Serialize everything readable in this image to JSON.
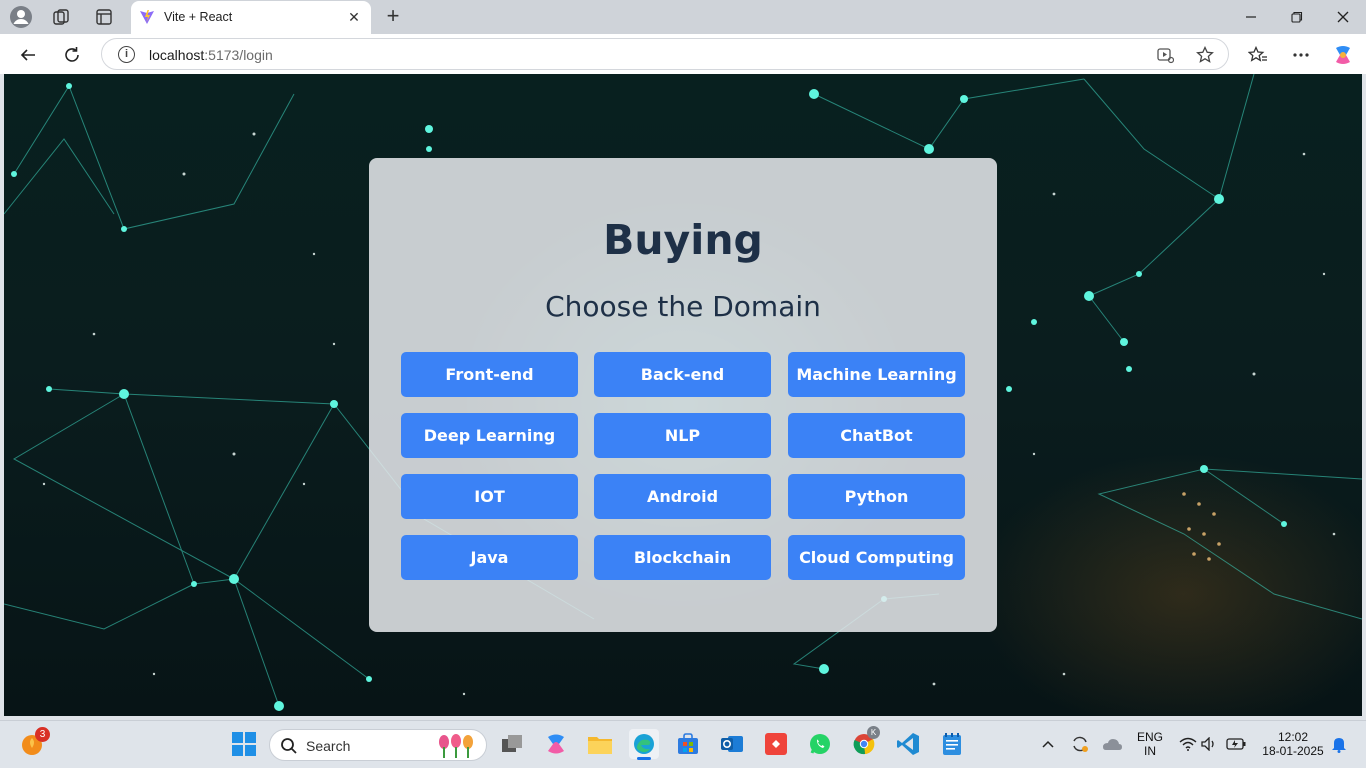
{
  "browser": {
    "tab_title": "Vite + React",
    "new_tab": "+",
    "tab_close": "✕",
    "url_host": "localhost",
    "url_rest": ":5173/login",
    "info_icon": "i"
  },
  "card": {
    "title": "Buying",
    "subtitle": "Choose the Domain",
    "domains": [
      "Front-end",
      "Back-end",
      "Machine Learning",
      "Deep Learning",
      "NLP",
      "ChatBot",
      "IOT",
      "Android",
      "Python",
      "Java",
      "Blockchain",
      "Cloud Computing"
    ]
  },
  "taskbar": {
    "search_label": "Search",
    "notification_badge": "3",
    "chrome_badge": "K",
    "lang_primary": "ENG",
    "lang_secondary": "IN",
    "time": "12:02",
    "date": "18-01-2025"
  },
  "colors": {
    "button": "#3b82f6",
    "title": "#1e3047",
    "card_bg": "#e8eaed"
  }
}
